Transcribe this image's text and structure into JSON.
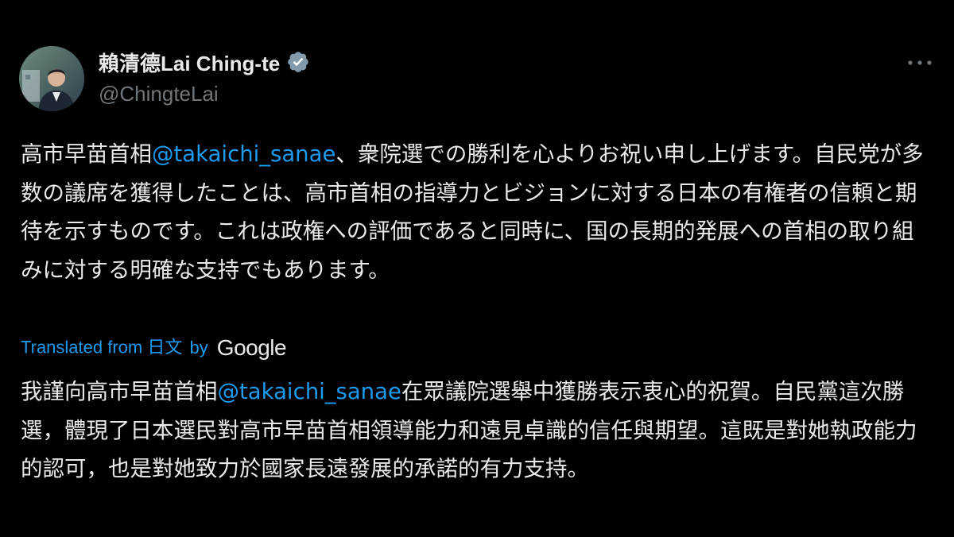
{
  "author": {
    "display_name": "賴清德Lai Ching-te",
    "handle": "@ChingteLai",
    "verified": true
  },
  "icons": {
    "more": "more-horizontal-icon",
    "verified": "verified-badge-icon"
  },
  "tweet": {
    "original": {
      "before_mention": "高市早苗首相",
      "mention": "@takaichi_sanae",
      "after_mention": "、衆院選での勝利を心よりお祝い申し上げます。自民党が多数の議席を獲得したことは、高市首相の指導力とビジョンに対する日本の有権者の信頼と期待を示すものです。これは政権への評価であると同時に、国の長期的発展への首相の取り組みに対する明確な支持でもあります。"
    },
    "translation_notice": {
      "label": "Translated from 日文",
      "by": "by",
      "provider": "Google"
    },
    "translation": {
      "before_mention": "我謹向高市早苗首相",
      "mention": "@takaichi_sanae",
      "after_mention": "在眾議院選舉中獲勝表示衷心的祝賀。自民黨這次勝選，體現了日本選民對高市早苗首相領導能力和遠見卓識的信任與期望。這既是對她執政能力的認可，也是對她致力於國家長遠發展的承諾的有力支持。"
    }
  },
  "colors": {
    "background": "#000000",
    "text": "#e7e9ea",
    "secondary_text": "#71767b",
    "accent": "#1d9bf0"
  }
}
